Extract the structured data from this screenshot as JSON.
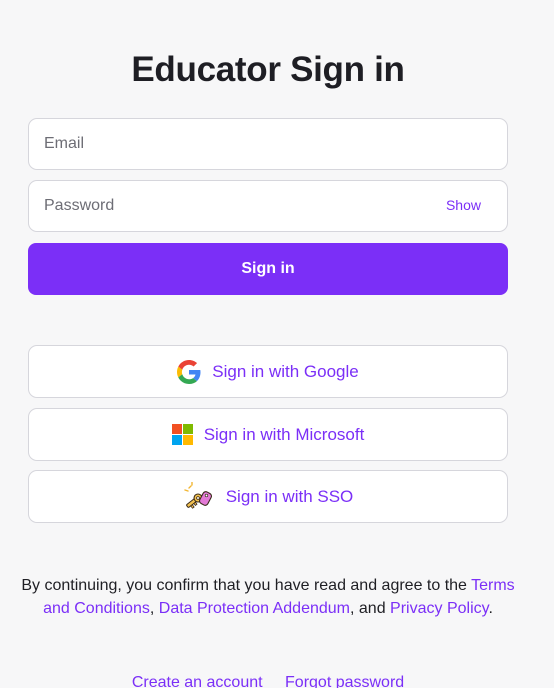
{
  "header": {
    "title": "Educator Sign in"
  },
  "form": {
    "email_placeholder": "Email",
    "email_value": "",
    "password_placeholder": "Password",
    "password_value": "",
    "show_label": "Show",
    "submit_label": "Sign in"
  },
  "oauth": {
    "google_label": "Sign in with Google",
    "microsoft_label": "Sign in with Microsoft",
    "sso_label": "Sign in with SSO",
    "google_icon": "google-g-icon",
    "microsoft_icon": "microsoft-logo-icon",
    "sso_icon": "keys-icon"
  },
  "legal": {
    "prefix": "By continuing, you confirm that you have read and agree to the",
    "terms_link": "Terms and Conditions",
    "sep1": ",",
    "dpa_link": "Data Protection Addendum",
    "sep2": ", and",
    "privacy_link": "Privacy Policy",
    "suffix": "."
  },
  "footer": {
    "create_account": "Create an account",
    "forgot_password": "Forgot password"
  },
  "colors": {
    "accent": "#7b2ff7",
    "background": "#f7f7f8",
    "border": "#d6d6dc"
  }
}
